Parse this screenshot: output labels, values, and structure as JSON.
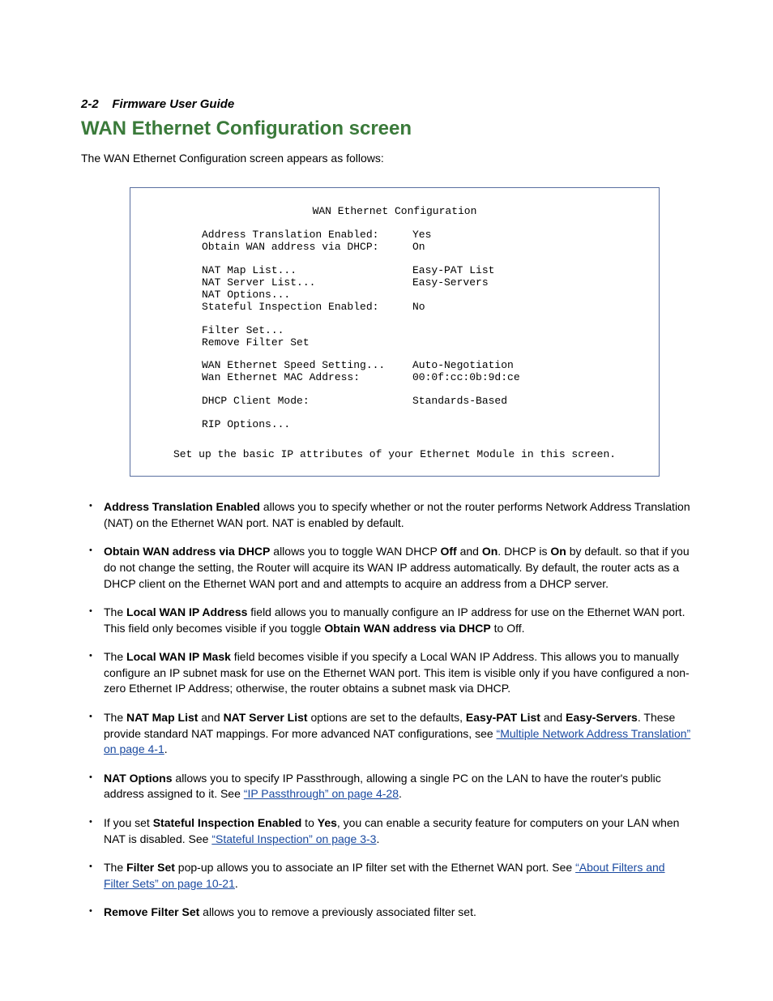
{
  "header": {
    "page_ref": "2-2",
    "guide_title": "Firmware User Guide"
  },
  "section": {
    "title": "WAN Ethernet Configuration screen",
    "intro": "The WAN Ethernet Configuration screen appears as follows:"
  },
  "console": {
    "title": "WAN Ethernet Configuration",
    "rows": [
      {
        "label": "Address Translation Enabled:",
        "value": "Yes"
      },
      {
        "label": "Obtain WAN address via DHCP:",
        "value": "On"
      }
    ],
    "rows2": [
      {
        "label": "NAT Map List...",
        "value": "Easy-PAT List"
      },
      {
        "label": "NAT Server List...",
        "value": "Easy-Servers"
      },
      {
        "label": "NAT Options...",
        "value": ""
      },
      {
        "label": "Stateful Inspection Enabled:",
        "value": "No"
      }
    ],
    "rows3": [
      {
        "label": "Filter Set...",
        "value": ""
      },
      {
        "label": "Remove Filter Set",
        "value": ""
      }
    ],
    "rows4": [
      {
        "label": "WAN Ethernet Speed Setting...",
        "value": "Auto-Negotiation"
      },
      {
        "label": "Wan Ethernet MAC Address:",
        "value": "00:0f:cc:0b:9d:ce"
      }
    ],
    "rows5": [
      {
        "label": "DHCP Client Mode:",
        "value": "Standards-Based"
      }
    ],
    "rows6": [
      {
        "label": "RIP Options...",
        "value": ""
      }
    ],
    "footer": "Set up the basic IP attributes of your Ethernet Module in this screen."
  },
  "bullets": {
    "b1": {
      "bold1": "Address Translation Enabled",
      "text1": " allows you to specify whether or not the router performs Network Address Translation (NAT) on the Ethernet WAN port. NAT is enabled by default."
    },
    "b2": {
      "bold1": "Obtain WAN address via DHCP",
      "text1": " allows you to toggle WAN DHCP ",
      "bold2": "Off",
      "text2": " and ",
      "bold3": "On",
      "text3": ". DHCP is ",
      "bold4": "On",
      "text4": " by default. so that if you do not change the setting, the Router will acquire its WAN IP address automatically. By default, the router acts as a DHCP client on the Ethernet WAN port and and attempts to acquire an address from a DHCP server."
    },
    "b3": {
      "text1": "The ",
      "bold1": "Local WAN IP Address",
      "text2": " field allows you to manually configure an IP address for use on the Ethernet WAN port. This field only becomes visible if you toggle ",
      "bold2": "Obtain WAN address via DHCP",
      "text3": " to Off."
    },
    "b4": {
      "text1": "The ",
      "bold1": "Local WAN IP Mask",
      "text2": " field becomes visible if you specify a Local WAN IP Address. This allows you to manually configure an IP subnet mask for use on the Ethernet WAN port. This item is visible only if you have configured a non-zero Ethernet IP Address; otherwise, the router obtains a subnet mask via DHCP."
    },
    "b5": {
      "text1": "The ",
      "bold1": "NAT Map List",
      "text2": " and ",
      "bold2": "NAT Server List",
      "text3": " options are set to the defaults, ",
      "bold3": "Easy-PAT List",
      "text4": " and ",
      "bold4": "Easy-Servers",
      "text5": ". These provide standard NAT mappings. For more advanced NAT configurations, see ",
      "link1": "“Multiple Network Address Translation” on page 4-1",
      "text6": "."
    },
    "b6": {
      "bold1": "NAT Options",
      "text1": " allows you to specify IP Passthrough, allowing a single PC on the LAN to have the router's public address assigned to it. See ",
      "link1": "“IP Passthrough” on page 4-28",
      "text2": "."
    },
    "b7": {
      "text1": "If you set ",
      "bold1": "Stateful Inspection Enabled",
      "text2": " to ",
      "bold2": "Yes",
      "text3": ", you can enable a security feature for computers on your LAN when NAT is disabled. See ",
      "link1": "“Stateful Inspection” on page 3-3",
      "text4": "."
    },
    "b8": {
      "text1": "The ",
      "bold1": "Filter Set",
      "text2": " pop-up allows you to associate an IP filter set with the Ethernet WAN port. See ",
      "link1": "“About Filters and Filter Sets” on page 10-21",
      "text3": "."
    },
    "b9": {
      "bold1": "Remove Filter Set",
      "text1": " allows you to remove a previously associated filter set."
    }
  }
}
